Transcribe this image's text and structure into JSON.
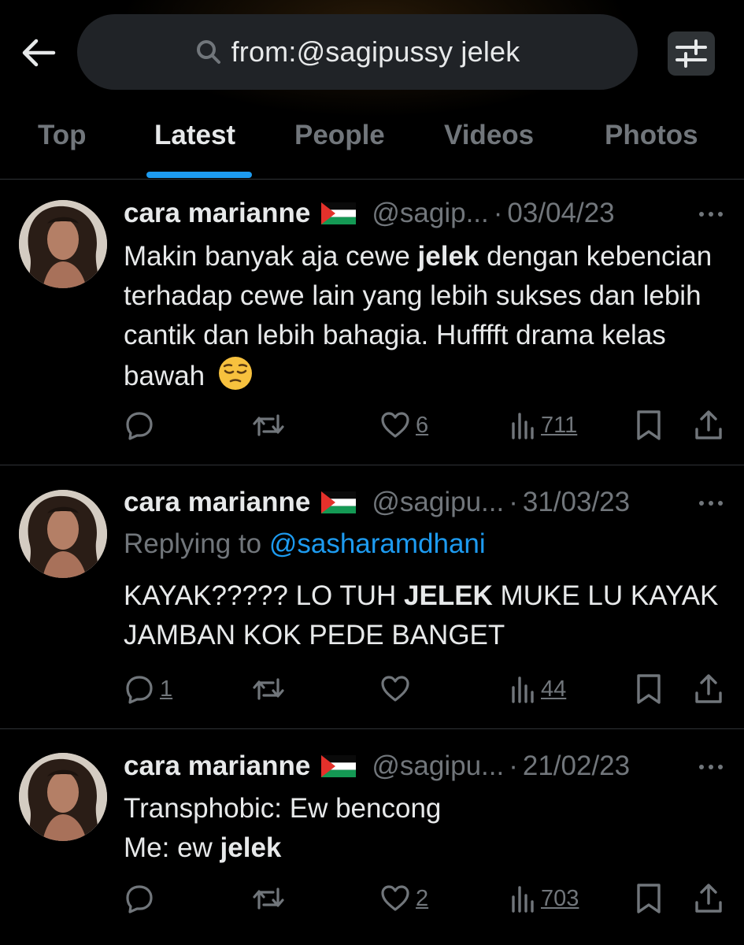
{
  "search": {
    "query": "from:@sagipussy jelek"
  },
  "tabs": [
    {
      "label": "Top"
    },
    {
      "label": "Latest",
      "active": true
    },
    {
      "label": "People"
    },
    {
      "label": "Videos"
    },
    {
      "label": "Photos"
    }
  ],
  "colors": {
    "accent": "#1d9bf0",
    "muted": "#71767b",
    "text": "#e7e9ea",
    "background": "#000000"
  },
  "tweets": [
    {
      "name": "cara marianne",
      "handle": "@sagip...",
      "dot": "·",
      "date": "03/04/23",
      "text_parts": [
        "Makin banyak aja cewe ",
        "jelek",
        " dengan kebencian terhadap cewe lain yang lebih sukses dan lebih cantik dan lebih bahagia. Hufffft drama kelas bawah"
      ],
      "emoji": "pensive-face",
      "reply_count": "",
      "like_count": "6",
      "view_count": "711"
    },
    {
      "name": "cara marianne",
      "handle": "@sagipu...",
      "dot": "·",
      "date": "31/03/23",
      "replying_label": "Replying to ",
      "replying_handle": "@sasharamdhani",
      "text_parts": [
        "KAYAK????? LO TUH ",
        "JELEK",
        " MUKE LU KAYAK JAMBAN KOK PEDE BANGET"
      ],
      "reply_count": "1",
      "like_count": "",
      "view_count": "44"
    },
    {
      "name": "cara marianne",
      "handle": "@sagipu...",
      "dot": "·",
      "date": "21/02/23",
      "line1": "Transphobic: Ew bencong",
      "text_parts": [
        "Me: ew ",
        "jelek",
        ""
      ],
      "reply_count": "",
      "like_count": "2",
      "view_count": "703"
    }
  ]
}
